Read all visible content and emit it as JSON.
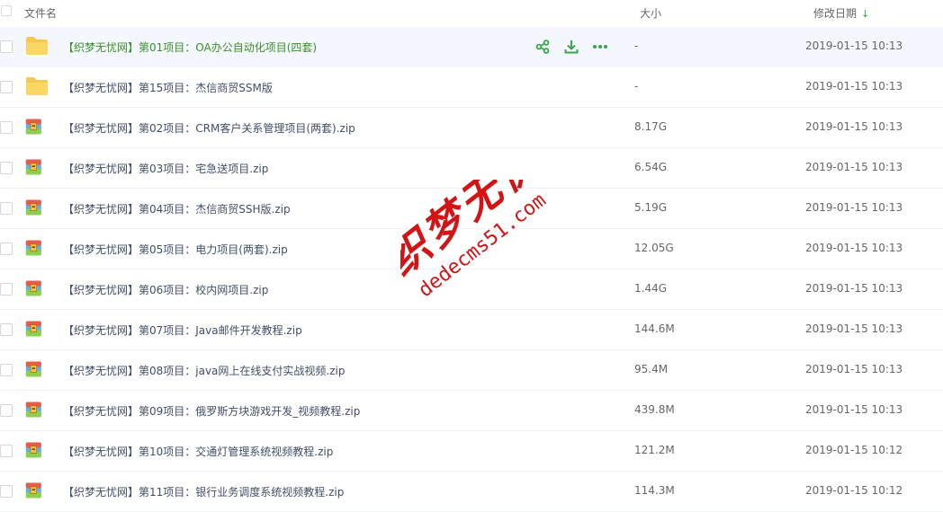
{
  "header": {
    "name_label": "文件名",
    "size_label": "大小",
    "date_label": "修改日期",
    "sort_indicator": "↓"
  },
  "colors": {
    "hover_row_bg": "#f4f7fd",
    "hover_name": "#3f8e2a",
    "accent_green": "#3aa54b",
    "folder": "#f6c84e",
    "zip_red": "#e85b4a"
  },
  "row_actions": [
    "share-icon",
    "download-icon",
    "more-icon"
  ],
  "files": [
    {
      "name": "【织梦无忧网】第01项目：OA办公自动化项目(四套)",
      "size": "-",
      "date": "2019-01-15 10:13",
      "icon": "folder-icon",
      "hover": true
    },
    {
      "name": "【织梦无忧网】第15项目：杰信商贸SSM版",
      "size": "-",
      "date": "2019-01-15 10:13",
      "icon": "folder-icon"
    },
    {
      "name": "【织梦无忧网】第02项目：CRM客户关系管理项目(两套).zip",
      "size": "8.17G",
      "date": "2019-01-15 10:13",
      "icon": "zip-icon"
    },
    {
      "name": "【织梦无忧网】第03项目：宅急送项目.zip",
      "size": "6.54G",
      "date": "2019-01-15 10:13",
      "icon": "zip-icon"
    },
    {
      "name": "【织梦无忧网】第04项目：杰信商贸SSH版.zip",
      "size": "5.19G",
      "date": "2019-01-15 10:13",
      "icon": "zip-icon"
    },
    {
      "name": "【织梦无忧网】第05项目：电力项目(两套).zip",
      "size": "12.05G",
      "date": "2019-01-15 10:13",
      "icon": "zip-icon"
    },
    {
      "name": "【织梦无忧网】第06项目：校内网项目.zip",
      "size": "1.44G",
      "date": "2019-01-15 10:13",
      "icon": "zip-icon"
    },
    {
      "name": "【织梦无忧网】第07项目：Java邮件开发教程.zip",
      "size": "144.6M",
      "date": "2019-01-15 10:13",
      "icon": "zip-icon"
    },
    {
      "name": "【织梦无忧网】第08项目：java网上在线支付实战视频.zip",
      "size": "95.4M",
      "date": "2019-01-15 10:13",
      "icon": "zip-icon"
    },
    {
      "name": "【织梦无忧网】第09项目：俄罗斯方块游戏开发_视频教程.zip",
      "size": "439.8M",
      "date": "2019-01-15 10:13",
      "icon": "zip-icon"
    },
    {
      "name": "【织梦无忧网】第10项目：交通灯管理系统视频教程.zip",
      "size": "121.2M",
      "date": "2019-01-15 10:12",
      "icon": "zip-icon"
    },
    {
      "name": "【织梦无忧网】第11项目：银行业务调度系统视频教程.zip",
      "size": "114.3M",
      "date": "2019-01-15 10:12",
      "icon": "zip-icon"
    }
  ],
  "watermark": {
    "chinese": "织梦无忧",
    "latin": "dedecms51.com"
  }
}
